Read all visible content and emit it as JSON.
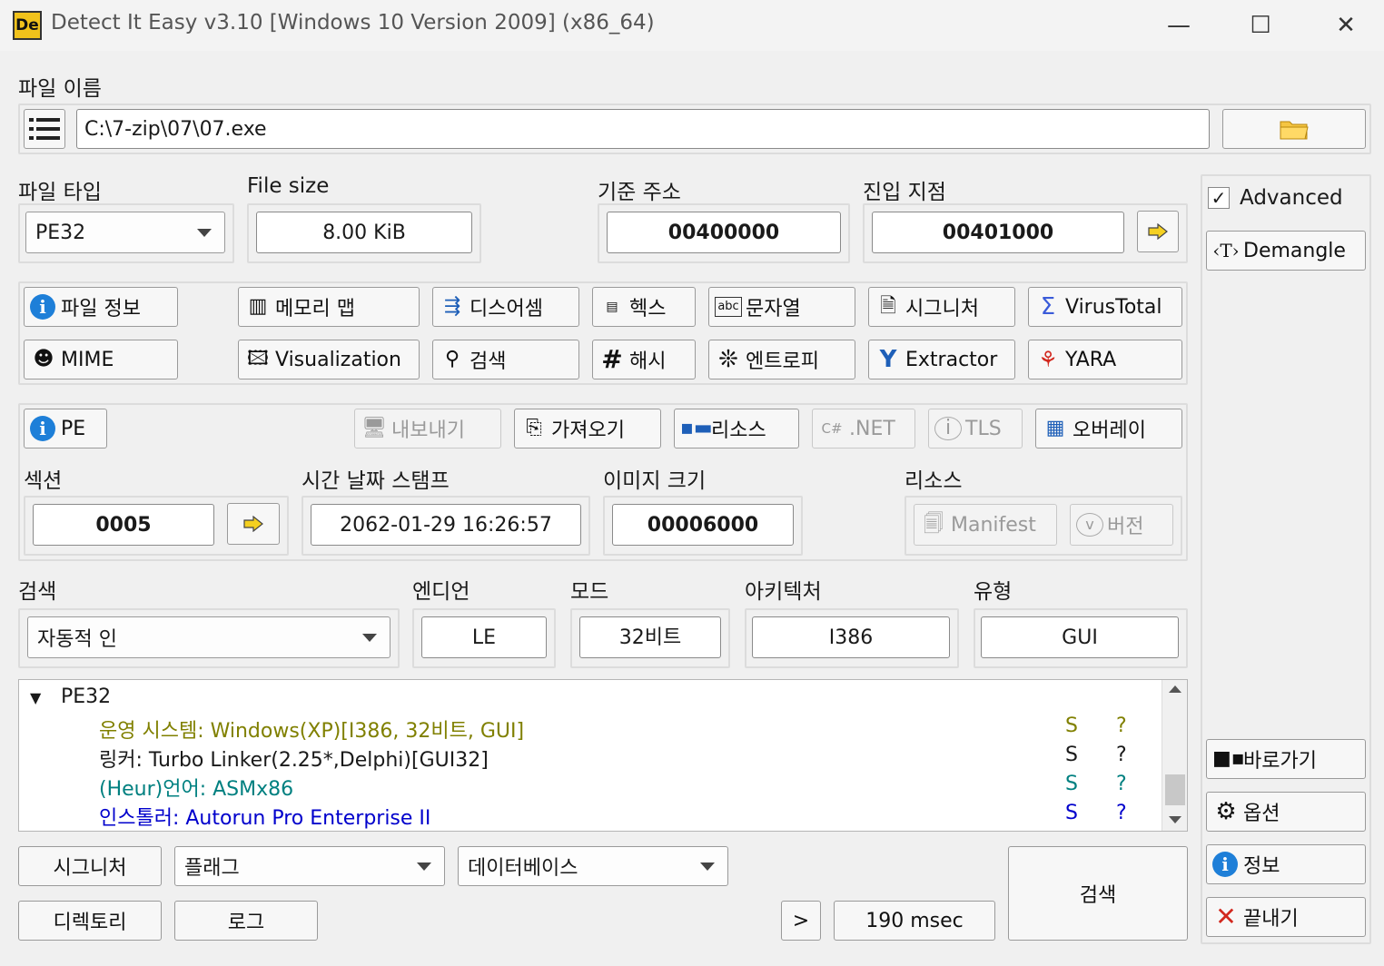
{
  "window": {
    "icon_text": "De",
    "title": "Detect It Easy v3.10 [Windows 10 Version 2009] (x86_64)",
    "minimize": "—",
    "maximize": "☐",
    "close": "✕"
  },
  "file": {
    "label": "파일 이름",
    "path": "C:\\7-zip\\07\\07.exe"
  },
  "info": {
    "file_type_label": "파일 타입",
    "file_type_value": "PE32",
    "file_size_label": "File size",
    "file_size_value": "8.00 KiB",
    "base_addr_label": "기준 주소",
    "base_addr_value": "00400000",
    "entry_label": "진입 지점",
    "entry_value": "00401000"
  },
  "tools": {
    "file_info": "파일 정보",
    "memory_map": "메모리 맵",
    "disasm": "디스어셈",
    "hex": "헥스",
    "strings": "문자열",
    "signatures": "시그니처",
    "virustotal": "VirusTotal",
    "mime": "MIME",
    "visualization": "Visualization",
    "search": "검색",
    "hash": "해시",
    "entropy": "엔트로피",
    "extractor": "Extractor",
    "yara": "YARA"
  },
  "pe": {
    "pe": "PE",
    "export": "내보내기",
    "import": "가져오기",
    "resources": "리소스",
    "net": ".NET",
    "tls": "TLS",
    "overlay": "오버레이",
    "sections_label": "섹션",
    "sections_value": "0005",
    "timestamp_label": "시간 날짜 스탬프",
    "timestamp_value": "2062-01-29 16:26:57",
    "image_size_label": "이미지 크기",
    "image_size_value": "00006000",
    "resources_label": "리소스",
    "manifest": "Manifest",
    "version": "버전"
  },
  "scan": {
    "search_label": "검색",
    "search_mode": "자동적 인",
    "endian_label": "엔디언",
    "endian_value": "LE",
    "mode_label": "모드",
    "mode_value": "32비트",
    "arch_label": "아키텍처",
    "arch_value": "I386",
    "type_label": "유형",
    "type_value": "GUI"
  },
  "results": {
    "root": "PE32",
    "rows": [
      {
        "text": "운영 시스템: Windows(XP)[I386, 32비트, GUI]",
        "s": "S",
        "q": "?",
        "color": "#808000"
      },
      {
        "text": "링커: Turbo Linker(2.25*,Delphi)[GUI32]",
        "s": "S",
        "q": "?",
        "color": "#1a1a1a"
      },
      {
        "text": "(Heur)언어: ASMx86",
        "s": "S",
        "q": "?",
        "color": "#008080"
      },
      {
        "text": "인스톨러: Autorun Pro Enterprise II",
        "s": "S",
        "q": "?",
        "color": "#0000cc"
      }
    ]
  },
  "sidebar": {
    "advanced": "Advanced",
    "demangle": "Demangle",
    "shortcuts": "바로가기",
    "options": "옵션",
    "about": "정보",
    "exit": "끝내기"
  },
  "bottom": {
    "signatures": "시그니처",
    "flags": "플래그",
    "database": "데이터베이스",
    "directory": "디렉토리",
    "log": "로그",
    "more": ">",
    "time": "190 msec",
    "scan": "검색"
  }
}
